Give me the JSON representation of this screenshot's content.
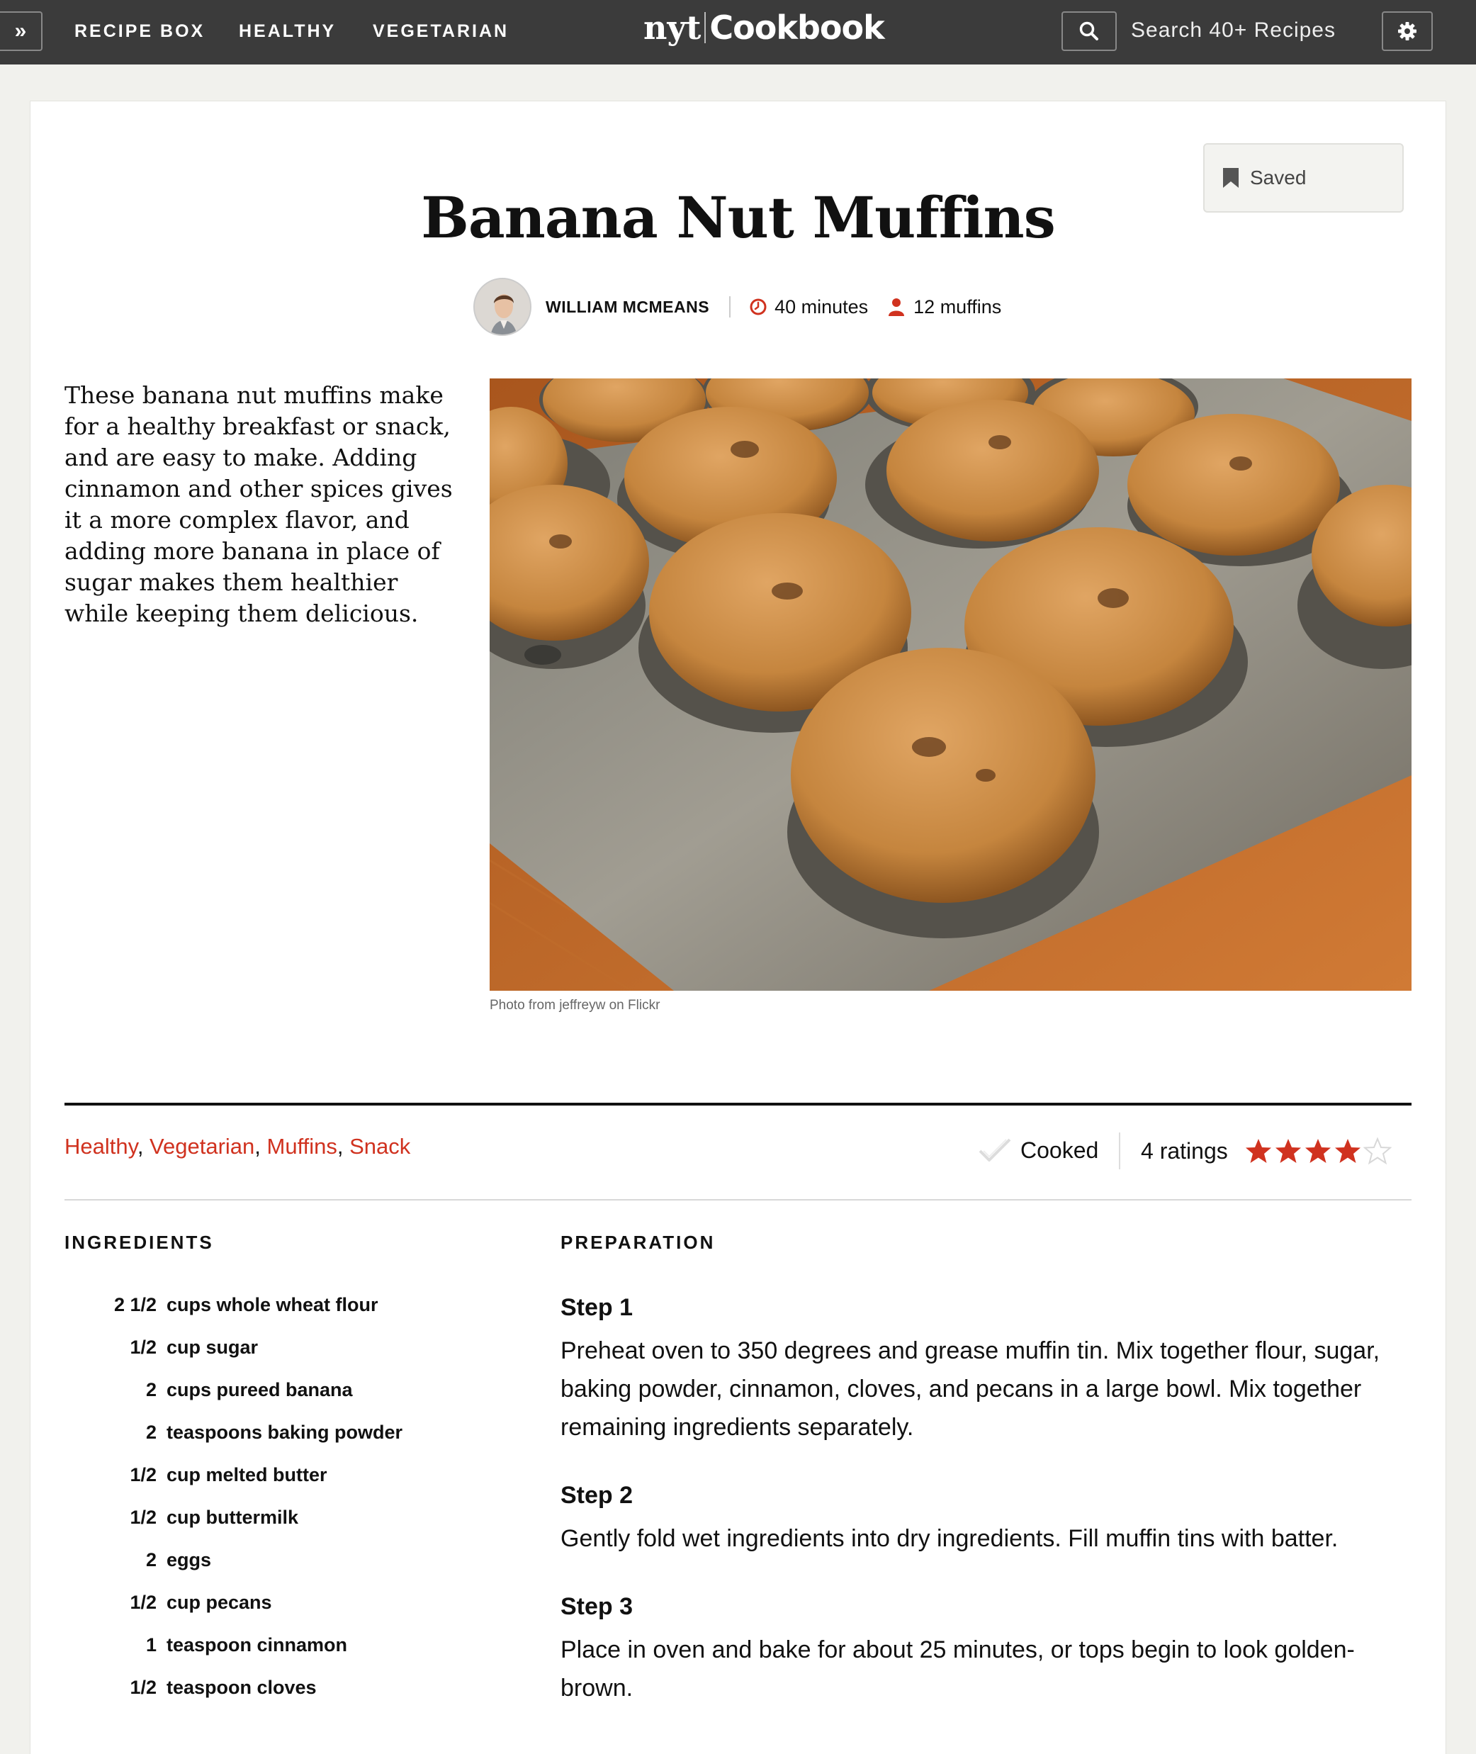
{
  "nav": {
    "items": [
      "RECIPE BOX",
      "HEALTHY",
      "VEGETARIAN"
    ],
    "logo_left": "nyt",
    "logo_right": "Cookbook",
    "search_placeholder": "Search 40+ Recipes"
  },
  "recipe": {
    "saved_label": "Saved",
    "title": "Banana Nut Muffins",
    "author": "WILLIAM MCMEANS",
    "time": "40 minutes",
    "yield": "12 muffins",
    "intro": "These banana nut muffins make for a healthy breakfast or snack, and are easy to make. Adding cinnamon and other spices gives it a more complex flavor, and adding more banana in place of sugar makes them healthier while keeping them delicious.",
    "photo_caption": "Photo from jeffreyw on Flickr",
    "tags": [
      "Healthy",
      "Vegetarian",
      "Muffins",
      "Snack"
    ],
    "cooked_label": "Cooked",
    "ratings_label": "4 ratings",
    "rating_value": 4,
    "rating_max": 5
  },
  "ingredients": {
    "heading": "INGREDIENTS",
    "items": [
      {
        "qty": "2 1/2",
        "text": "cups whole wheat flour"
      },
      {
        "qty": "1/2",
        "text": "cup sugar"
      },
      {
        "qty": "2",
        "text": "cups pureed banana"
      },
      {
        "qty": "2",
        "text": "teaspoons baking powder"
      },
      {
        "qty": "1/2",
        "text": "cup melted butter"
      },
      {
        "qty": "1/2",
        "text": "cup buttermilk"
      },
      {
        "qty": "2",
        "text": "eggs"
      },
      {
        "qty": "1/2",
        "text": "cup pecans"
      },
      {
        "qty": "1",
        "text": "teaspoon cinnamon"
      },
      {
        "qty": "1/2",
        "text": "teaspoon cloves"
      }
    ]
  },
  "preparation": {
    "heading": "PREPARATION",
    "steps": [
      {
        "title": "Step 1",
        "body": "Preheat oven to 350 degrees and grease muffin tin. Mix together flour, sugar, baking powder, cinnamon, cloves, and pecans in a large bowl. Mix together remaining ingredients separately."
      },
      {
        "title": "Step 2",
        "body": "Gently fold wet ingredients into dry ingredients. Fill muffin tins with batter."
      },
      {
        "title": "Step 3",
        "body": "Place in oven and bake for about 25 minutes, or tops begin to look golden-brown."
      }
    ]
  },
  "colors": {
    "accent_red": "#d0321f",
    "topbar": "#3b3b3b",
    "page_bg": "#f1f1ed"
  },
  "icons": [
    "chevron-double-right-icon",
    "search-icon",
    "gear-icon",
    "bookmark-icon",
    "clock-icon",
    "person-icon",
    "check-icon",
    "star-icon"
  ]
}
